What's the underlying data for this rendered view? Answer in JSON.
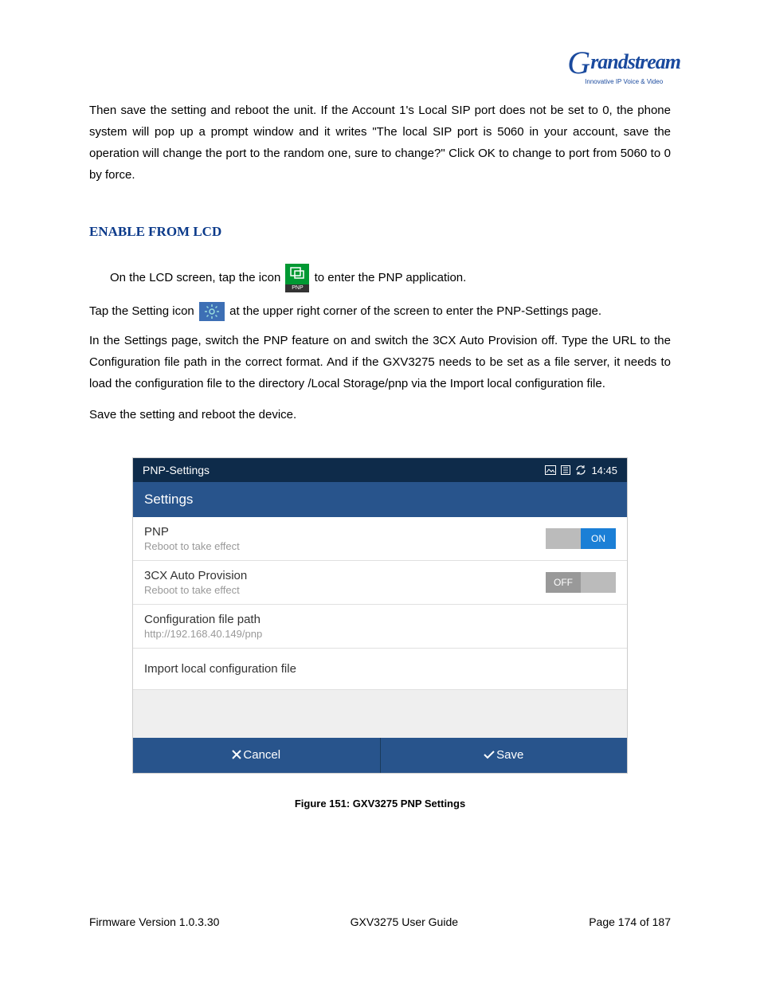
{
  "logo": {
    "brand": "randstream",
    "tagline": "Innovative IP Voice & Video"
  },
  "body": {
    "intro_para": "Then save the setting and reboot the unit. If the Account 1's Local SIP port does not be set to 0, the phone system will pop up a prompt window and it writes \"The local SIP port is 5060 in your account, save the operation will change the port to the random one, sure to change?\" Click OK to change to port from 5060 to 0 by force.",
    "section_heading": "ENABLE FROM LCD",
    "line1_a": "On the LCD screen, tap the icon ",
    "line1_b": " to enter the PNP application.",
    "line2_a": "Tap the Setting icon ",
    "line2_b": " at the upper right corner of the screen to enter the PNP-Settings page.",
    "para3": "In the Settings page, switch the PNP feature on and switch the 3CX Auto Provision off. Type the URL to the Configuration file path in the correct format. And if the GXV3275 needs to be set as a file server, it needs to load the configuration file to the directory /Local Storage/pnp via the Import local configuration file.",
    "para4": "Save the setting and reboot the device."
  },
  "device_ui": {
    "status_bar_title": "PNP-Settings",
    "status_bar_time": "14:45",
    "header": "Settings",
    "rows": {
      "pnp_label": "PNP",
      "pnp_sub": "Reboot to take effect",
      "pnp_toggle": "ON",
      "cx_label": "3CX Auto Provision",
      "cx_sub": "Reboot to take effect",
      "cx_toggle": "OFF",
      "config_label": "Configuration file path",
      "config_sub": "http://192.168.40.149/pnp",
      "import_label": "Import local configuration file"
    },
    "buttons": {
      "cancel": "Cancel",
      "save": "Save"
    }
  },
  "figure_caption": "Figure 151: GXV3275 PNP Settings",
  "footer": {
    "left": "Firmware Version 1.0.3.30",
    "center": "GXV3275 User Guide",
    "right": "Page 174 of 187"
  }
}
